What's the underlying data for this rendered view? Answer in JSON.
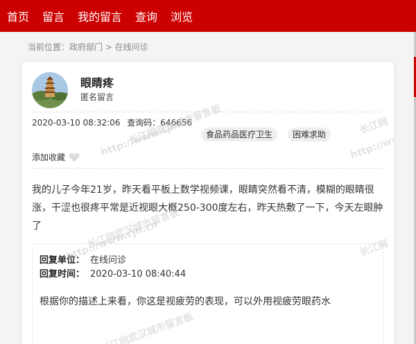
{
  "nav": [
    "首页",
    "留言",
    "我的留言",
    "查询",
    "浏览"
  ],
  "breadcrumb": "当前位置：政府部门 > 在线问诊",
  "message": {
    "title": "眼睛疼",
    "subtitle": "匿名留言",
    "datetime": "2020-03-10 08:32:06",
    "query_code": "查询码：646656",
    "tags": [
      "食品药品医疗卫生",
      "困难求助"
    ],
    "favorite_label": "添加收藏",
    "body": "我的儿子今年21岁，昨天看平板上数学视频课，眼睛突然看不清，模糊的眼睛很涨，干涩也很疼平常是近视眼大概250-300度左右，昨天热敷了一下，今天左眼肿了"
  },
  "reply": {
    "unit_label": "回复单位：",
    "unit": "在线问诊",
    "time_label": "回复时间：",
    "time": "2020-03-10 08:40:44",
    "text": "根据你的描述上来看，你这是视疲劳的表现，可以外用视疲劳眼药水"
  },
  "watermark": {
    "site": "长江网武汉城市留言板",
    "url": "http://www.cjn.cn",
    "short": "长江网"
  },
  "colors": {
    "brand_red": "#cc0000"
  },
  "icons": {
    "favorite": "heart-icon"
  }
}
